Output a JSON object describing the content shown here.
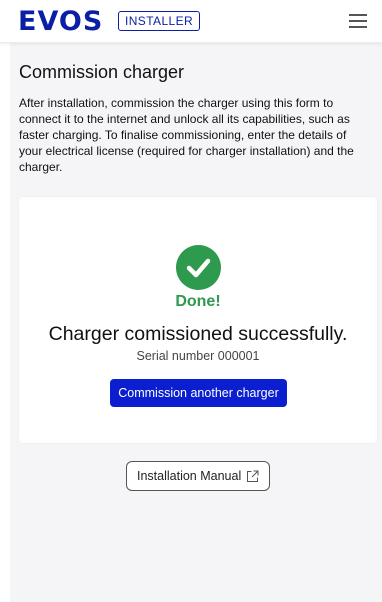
{
  "header": {
    "logo_text": "EVOS",
    "badge": "INSTALLER",
    "menu_icon": "hamburger-menu-icon"
  },
  "main": {
    "title": "Commission charger",
    "intro": "After installation, commission the charger using this form to connect it to the internet and unlock all its capabilities, such as faster charging. To finalise commissioning, enter the details of your electrical license (required for charger installation) and the charger."
  },
  "card": {
    "status_icon": "check-circle-icon",
    "status_label": "Done!",
    "message": "Charger comissioned successfully.",
    "serial": "Serial number 000001",
    "button_label": "Commission another charger"
  },
  "manual": {
    "label": "Installation Manual",
    "icon": "external-link-icon"
  },
  "colors": {
    "brand": "#0b1fa6",
    "primary_button": "#0b1fd0",
    "success": "#2d9a4e",
    "background": "#f5f5f7"
  }
}
